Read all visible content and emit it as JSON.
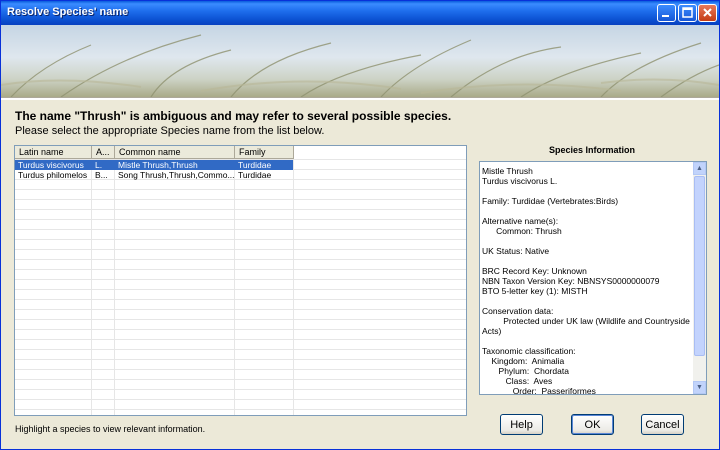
{
  "window": {
    "title": "Resolve Species' name"
  },
  "message": {
    "line1": "The name \"Thrush\" is ambiguous and may refer to several possible species.",
    "line2": "Please select the appropriate Species name from the list below."
  },
  "list": {
    "columns": [
      "Latin name",
      "A...",
      "Common name",
      "Family"
    ],
    "rows": [
      {
        "latin": "Turdus viscivorus",
        "a": "L.",
        "common": "Mistle Thrush,Thrush",
        "family": "Turdidae"
      },
      {
        "latin": "Turdus philomelos",
        "a": "B...",
        "common": "Song Thrush,Thrush,Commo...",
        "family": "Turdidae"
      }
    ]
  },
  "hint": "Highlight a species to view relevant information.",
  "info": {
    "title": "Species Information",
    "lines": [
      "Mistle Thrush",
      "Turdus viscivorus  L.",
      "",
      "Family:  Turdidae  (Vertebrates:Birds)",
      "",
      "Alternative name(s):",
      "      Common: Thrush",
      "",
      "UK Status: Native",
      "",
      "BRC Record Key: Unknown",
      "NBN Taxon Version Key: NBNSYS0000000079",
      "BTO 5-letter key (1): MISTH",
      "",
      "Conservation data:",
      "         Protected under UK law (Wildlife and Countryside",
      "Acts)",
      "",
      "Taxonomic classification:",
      "    Kingdom:  Animalia",
      "       Phylum:  Chordata",
      "          Class:  Aves",
      "             Order:  Passeriformes"
    ]
  },
  "buttons": {
    "help": "Help",
    "ok": "OK",
    "cancel": "Cancel"
  }
}
